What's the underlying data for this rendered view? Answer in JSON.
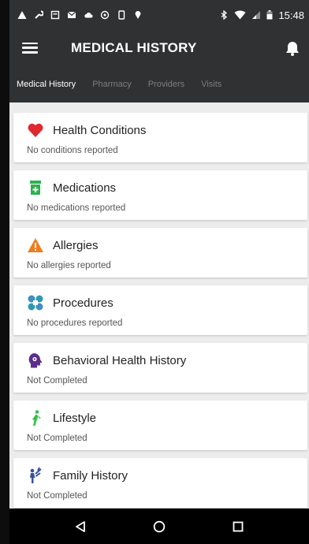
{
  "statusbar": {
    "time": "15:48"
  },
  "appbar": {
    "title": "MEDICAL HISTORY"
  },
  "tabs": [
    {
      "label": "Medical History",
      "active": true
    },
    {
      "label": "Pharmacy"
    },
    {
      "label": "Providers"
    },
    {
      "label": "Visits"
    }
  ],
  "cards": [
    {
      "title": "Health Conditions",
      "subtitle": "No conditions reported",
      "icon": "heart-icon",
      "color": "#e0282e"
    },
    {
      "title": "Medications",
      "subtitle": "No medications reported",
      "icon": "pill-bottle-icon",
      "color": "#2cb24e"
    },
    {
      "title": "Allergies",
      "subtitle": "No allergies reported",
      "icon": "warning-icon",
      "color": "#f07d1c"
    },
    {
      "title": "Procedures",
      "subtitle": "No procedures reported",
      "icon": "procedures-icon",
      "color": "#3f8fc0"
    },
    {
      "title": "Behavioral Health History",
      "subtitle": "Not Completed",
      "icon": "head-gear-icon",
      "color": "#5a2e8a"
    },
    {
      "title": "Lifestyle",
      "subtitle": "Not Completed",
      "icon": "runner-icon",
      "color": "#34c24a"
    },
    {
      "title": "Family History",
      "subtitle": "Not Completed",
      "icon": "family-icon",
      "color": "#3552a0"
    }
  ]
}
